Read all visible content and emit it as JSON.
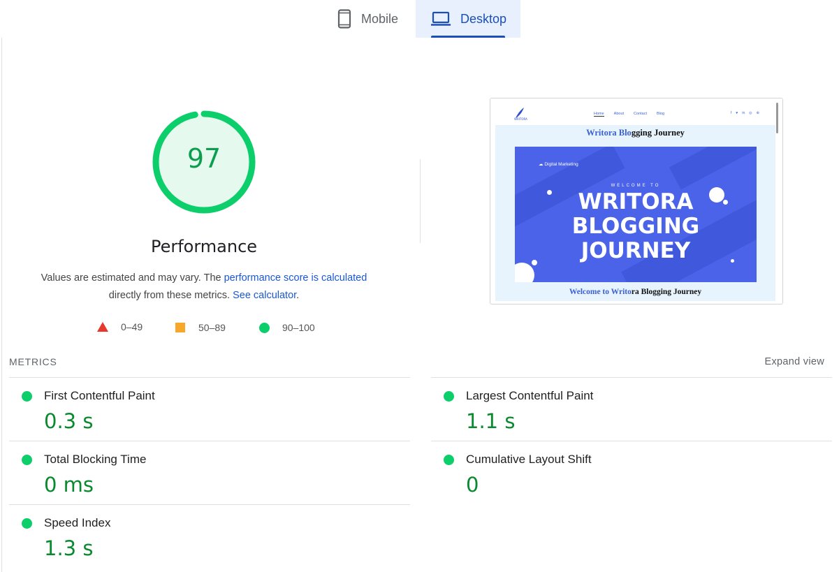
{
  "tabs": [
    {
      "label": "Mobile",
      "icon": "mobile-phone-icon",
      "active": false
    },
    {
      "label": "Desktop",
      "icon": "laptop-icon",
      "active": true
    }
  ],
  "score": {
    "value": "97",
    "value_fraction": 0.97,
    "title": "Performance",
    "color": "#0cce6b"
  },
  "description": {
    "part1": "Values are estimated and may vary. The ",
    "link1": "performance score is calculated",
    "part2": "directly from these metrics.",
    "link2": "See calculator",
    "part3": "."
  },
  "legend": [
    {
      "range": "0–49",
      "shape": "triangle",
      "color": "#e8372d"
    },
    {
      "range": "50–89",
      "shape": "square",
      "color": "#f7a72c"
    },
    {
      "range": "90–100",
      "shape": "circle",
      "color": "#0cce6b"
    }
  ],
  "screenshot": {
    "nav_links": [
      "Home",
      "About",
      "Contact",
      "Blog"
    ],
    "social_icons": [
      "facebook-icon",
      "twitter-icon",
      "linkedin-icon",
      "instagram-icon",
      "globe-icon"
    ],
    "heading_blue": "Writora Blo",
    "heading_black": "gging Journey",
    "hero_tag": "Digital Marketing",
    "hero_welcome": "WELCOME TO",
    "hero_title_1": "WRITORA",
    "hero_title_2": "BLOGGING",
    "hero_title_3": "JOURNEY",
    "footer_blue": "Welcome to Writo",
    "footer_black": "ra Blogging Journey"
  },
  "metrics": {
    "title": "METRICS",
    "expand_label": "Expand view",
    "items": [
      {
        "label": "First Contentful Paint",
        "value": "0.3 s"
      },
      {
        "label": "Largest Contentful Paint",
        "value": "1.1 s"
      },
      {
        "label": "Total Blocking Time",
        "value": "0 ms"
      },
      {
        "label": "Cumulative Layout Shift",
        "value": "0"
      },
      {
        "label": "Speed Index",
        "value": "1.3 s"
      }
    ]
  }
}
